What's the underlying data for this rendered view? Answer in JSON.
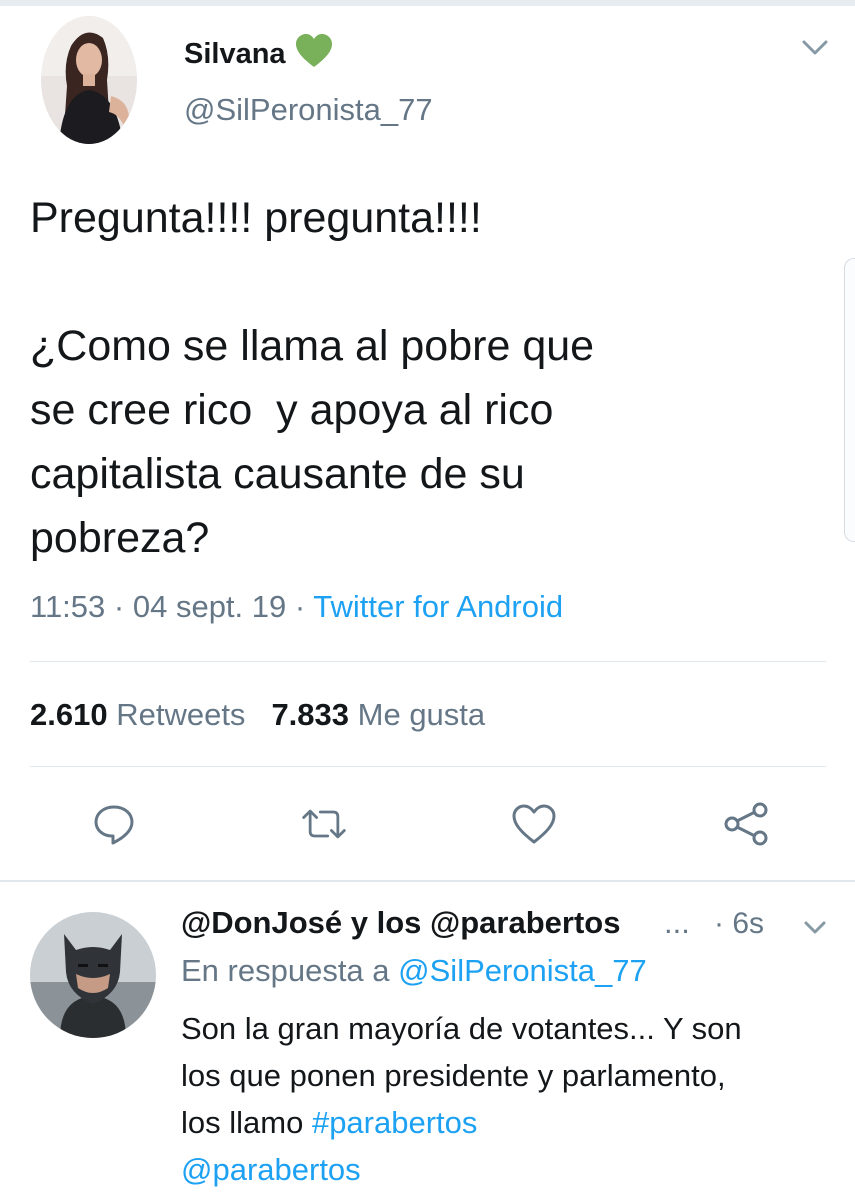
{
  "tweet": {
    "author_name": "Silvana",
    "badge_icon": "green-heart-icon",
    "author_handle": "@SilPeronista_77",
    "text_line1": "Pregunta!!!! pregunta!!!!",
    "text_line2": "¿Como se llama al pobre que",
    "text_line3": "se cree rico  y apoya al rico",
    "text_line4": "capitalista causante de su",
    "text_line5": "pobreza?",
    "time": "11:53",
    "date": "04 sept. 19",
    "separator": "·",
    "source": "Twitter for Android",
    "retweets_count": "2.610",
    "retweets_label": "Retweets",
    "likes_count": "7.833",
    "likes_label": "Me gusta"
  },
  "actions": [
    "reply-icon",
    "retweet-icon",
    "like-icon",
    "share-icon"
  ],
  "reply": {
    "author_name": "@DonJosé y los @parabertos",
    "ellipsis": "...",
    "time": "· 6s",
    "in_reply_prefix": "En respuesta a",
    "in_reply_handle": "@SilPeronista_77",
    "text_line1": "Son la gran mayoría de votantes... Y son",
    "text_line2": "los que ponen presidente y parlamento,",
    "text_line3_prefix": "los llamo",
    "hashtag": "#parabertos",
    "mention": "@parabertos"
  },
  "colors": {
    "accent": "#1da1f2",
    "secondary_text": "#657786",
    "primary_text": "#14171a",
    "badge": "#78b159"
  }
}
